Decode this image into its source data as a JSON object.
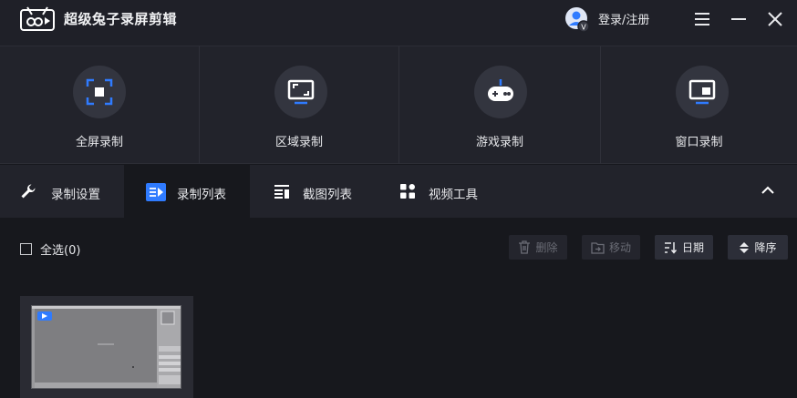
{
  "app": {
    "title": "超级兔子录屏剪辑",
    "logo_icon": "rabbit-logo-icon",
    "accent_color": "#2f7bff"
  },
  "header": {
    "login_label": "登录/注册",
    "avatar_icon": "user-avatar-icon",
    "menu_icon": "hamburger-icon",
    "minimize_icon": "minimize-icon",
    "close_icon": "close-icon"
  },
  "modes": [
    {
      "label": "全屏录制",
      "icon": "fullscreen-record-icon"
    },
    {
      "label": "区域录制",
      "icon": "region-record-icon"
    },
    {
      "label": "游戏录制",
      "icon": "gamepad-icon"
    },
    {
      "label": "窗口录制",
      "icon": "window-record-icon"
    }
  ],
  "tabs": [
    {
      "label": "录制设置",
      "icon": "wrench-icon",
      "active": false
    },
    {
      "label": "录制列表",
      "icon": "video-list-icon",
      "active": true
    },
    {
      "label": "截图列表",
      "icon": "screenshot-list-icon",
      "active": false
    },
    {
      "label": "视频工具",
      "icon": "tools-grid-icon",
      "active": false
    }
  ],
  "list_toolbar": {
    "select_all_label": "全选(0)",
    "delete_label": "删除",
    "move_label": "移动",
    "date_sort_label": "日期",
    "order_label": "降序"
  },
  "recordings": [
    {
      "thumbnail": "screen-recording-thumbnail"
    }
  ]
}
